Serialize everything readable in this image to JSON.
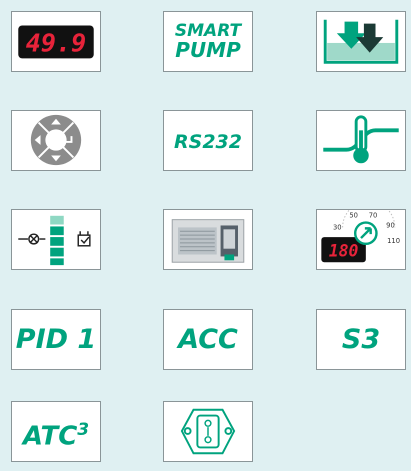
{
  "accent_color": "#00a37e",
  "display_red": "#e8233a",
  "tiles": {
    "digital_display": {
      "value": "49.9",
      "icon": "digital-display-icon"
    },
    "smart_pump": {
      "line1": "SMART",
      "line2": "PUMP",
      "icon": "smart-pump-icon"
    },
    "bath_fill": {
      "icon": "bath-fill-arrows-icon"
    },
    "keypad": {
      "icon": "navigation-keypad-icon"
    },
    "rs232": {
      "label": "RS232",
      "icon": "rs232-icon"
    },
    "temp_control": {
      "icon": "temperature-control-icon"
    },
    "pump_level": {
      "icon": "pump-level-bar-icon"
    },
    "unit_photo": {
      "icon": "circulator-unit-photo"
    },
    "dial_display": {
      "value": "180",
      "scale": [
        "30",
        "50",
        "70",
        "90",
        "110"
      ],
      "icon": "dial-display-icon"
    },
    "pid1": {
      "label": "PID 1"
    },
    "acc": {
      "label": "ACC"
    },
    "s3": {
      "label": "S3"
    },
    "atc3": {
      "label": "ATC",
      "superscript": "3"
    },
    "connector": {
      "icon": "power-connector-icon"
    }
  }
}
